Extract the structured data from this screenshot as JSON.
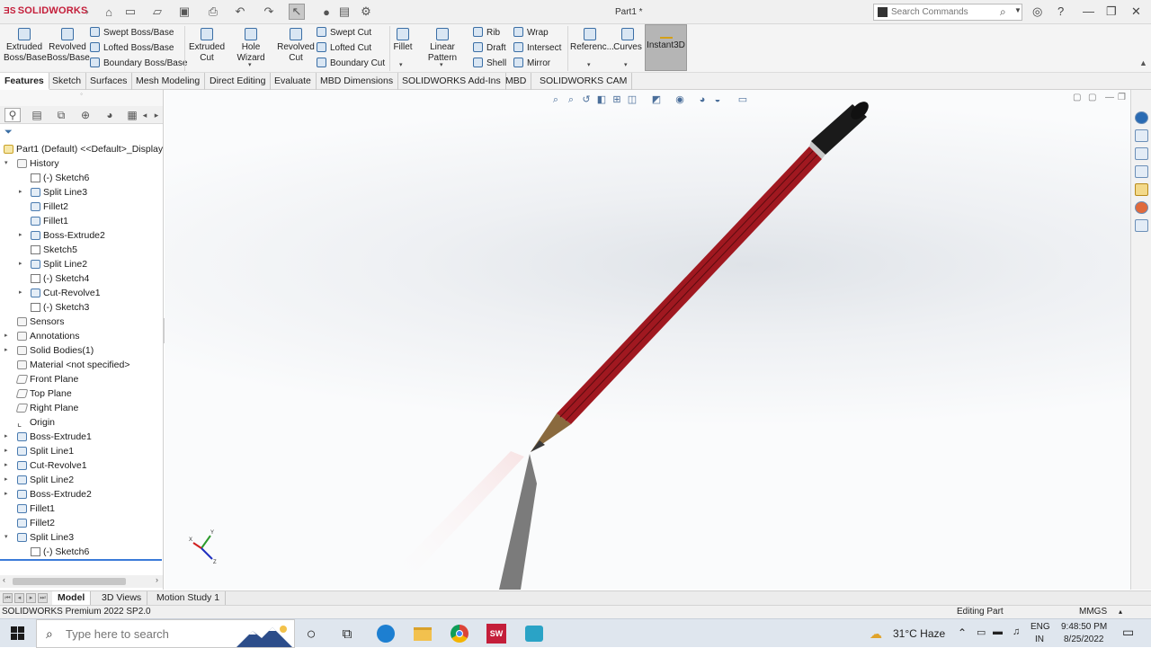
{
  "app": {
    "logo_text": "SOLIDWORKS",
    "document_title": "Part1 *",
    "search_placeholder": "Search Commands"
  },
  "ribbon": {
    "buttons": [
      {
        "label": "Extruded Boss/Base"
      },
      {
        "label": "Revolved Boss/Base"
      },
      {
        "label": "Swept Boss/Base"
      },
      {
        "label": "Lofted Boss/Base"
      },
      {
        "label": "Boundary Boss/Base"
      },
      {
        "label": "Extruded Cut"
      },
      {
        "label": "Hole Wizard"
      },
      {
        "label": "Revolved Cut"
      },
      {
        "label": "Swept Cut"
      },
      {
        "label": "Lofted Cut"
      },
      {
        "label": "Boundary Cut"
      },
      {
        "label": "Fillet"
      },
      {
        "label": "Linear Pattern"
      },
      {
        "label": "Rib"
      },
      {
        "label": "Draft"
      },
      {
        "label": "Shell"
      },
      {
        "label": "Wrap"
      },
      {
        "label": "Intersect"
      },
      {
        "label": "Mirror"
      },
      {
        "label": "Referenc..."
      },
      {
        "label": "Curves"
      },
      {
        "label": "Instant3D"
      }
    ]
  },
  "command_tabs": [
    {
      "label": "Features",
      "active": true
    },
    {
      "label": "Sketch"
    },
    {
      "label": "Surfaces"
    },
    {
      "label": "Mesh Modeling"
    },
    {
      "label": "Direct Editing"
    },
    {
      "label": "Evaluate"
    },
    {
      "label": "MBD Dimensions"
    },
    {
      "label": "SOLIDWORKS Add-Ins"
    },
    {
      "label": "MBD"
    },
    {
      "label": "SOLIDWORKS CAM"
    }
  ],
  "tree": {
    "root_label": "Part1 (Default) <<Default>_Display S",
    "items": [
      {
        "label": "History"
      },
      {
        "label": "(-) Sketch6"
      },
      {
        "label": "Split Line3"
      },
      {
        "label": "Fillet2"
      },
      {
        "label": "Fillet1"
      },
      {
        "label": "Boss-Extrude2"
      },
      {
        "label": "Sketch5"
      },
      {
        "label": "Split Line2"
      },
      {
        "label": "(-) Sketch4"
      },
      {
        "label": "Cut-Revolve1"
      },
      {
        "label": "(-) Sketch3"
      },
      {
        "label": "Sensors"
      },
      {
        "label": "Annotations"
      },
      {
        "label": "Solid Bodies(1)"
      },
      {
        "label": "Material <not specified>"
      },
      {
        "label": "Front Plane"
      },
      {
        "label": "Top Plane"
      },
      {
        "label": "Right Plane"
      },
      {
        "label": "Origin"
      },
      {
        "label": "Boss-Extrude1"
      },
      {
        "label": "Split Line1"
      },
      {
        "label": "Cut-Revolve1"
      },
      {
        "label": "Split Line2"
      },
      {
        "label": "Boss-Extrude2"
      },
      {
        "label": "Fillet1"
      },
      {
        "label": "Fillet2"
      },
      {
        "label": "Split Line3"
      },
      {
        "label": "(-) Sketch6"
      }
    ]
  },
  "triad": {
    "x": "X",
    "y": "Y",
    "z": "Z"
  },
  "bottom_tabs": [
    {
      "label": "Model",
      "active": true
    },
    {
      "label": "3D Views"
    },
    {
      "label": "Motion Study 1"
    }
  ],
  "status": {
    "product": "SOLIDWORKS Premium 2022 SP2.0",
    "mode": "Editing Part",
    "units": "MMGS"
  },
  "taskbar": {
    "search_placeholder": "Type here to search",
    "weather": "31°C  Haze",
    "language_line1": "ENG",
    "language_line2": "IN",
    "time": "9:48:50 PM",
    "date": "8/25/2022"
  },
  "colors": {
    "pencil_body": "#a01820",
    "pencil_cap": "#1a1a1a",
    "pencil_wood": "#8a6a3e",
    "accent": "#3b7bd8"
  }
}
